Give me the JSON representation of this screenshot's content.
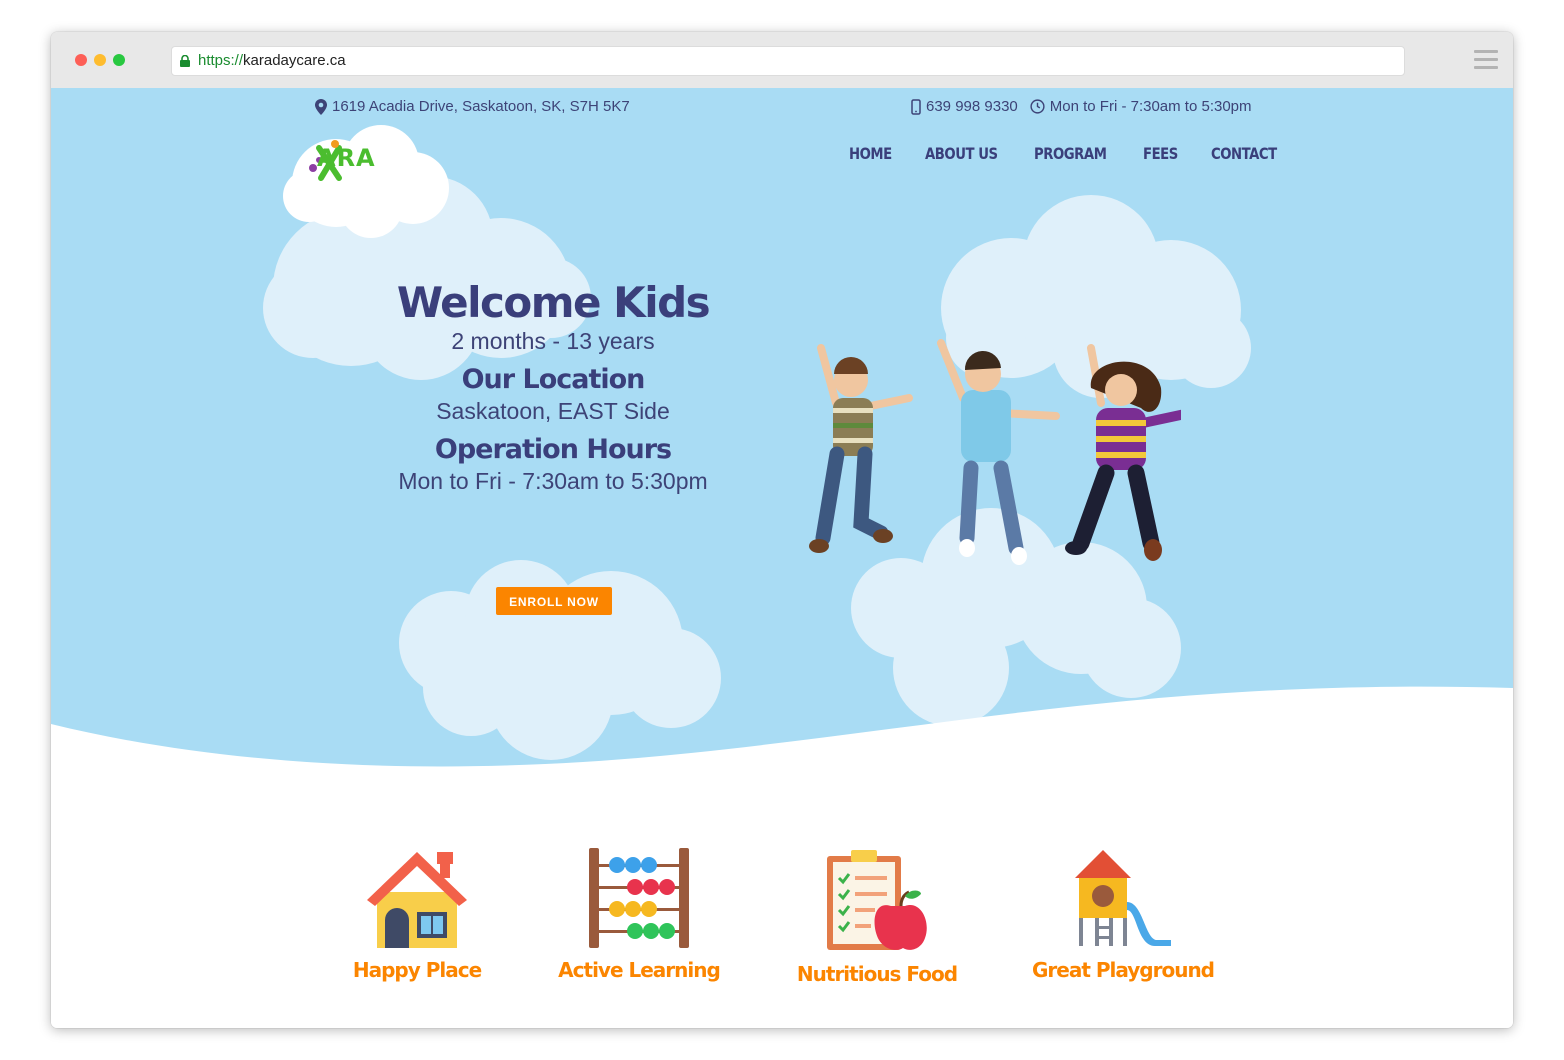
{
  "browser": {
    "url_scheme": "https://",
    "url_host": "karadaycare.ca"
  },
  "topbar": {
    "address": "1619 Acadia Drive, Saskatoon, SK, S7H 5K7",
    "phone": "639 998 9330",
    "hours": "Mon to Fri - 7:30am to 5:30pm"
  },
  "logo": {
    "text": "ARA"
  },
  "nav": [
    "HOME",
    "ABOUT US",
    "PROGRAM",
    "FEES",
    "CONTACT"
  ],
  "hero": {
    "title": "Welcome Kids",
    "age_range": "2 months - 13 years",
    "location_heading": "Our Location",
    "location_value": "Saskatoon, EAST Side",
    "hours_heading": "Operation Hours",
    "hours_value": "Mon to Fri - 7:30am to 5:30pm",
    "cta": "ENROLL NOW"
  },
  "features": [
    {
      "icon": "house-icon",
      "label": "Happy Place"
    },
    {
      "icon": "abacus-icon",
      "label": "Active Learning"
    },
    {
      "icon": "clipboard-apple-icon",
      "label": "Nutritious Food"
    },
    {
      "icon": "playground-icon",
      "label": "Great Playground"
    }
  ],
  "colors": {
    "sky": "#a9dcf4",
    "cloud": "#dff0fa",
    "navy": "#3a3f7b",
    "orange": "#fb8500",
    "logo_green": "#4bbd2f"
  }
}
